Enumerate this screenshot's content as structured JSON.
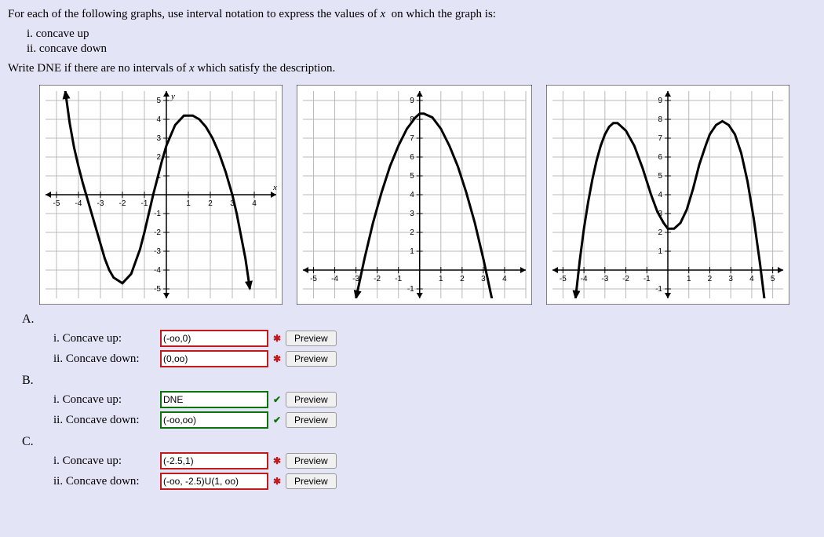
{
  "prompt": "For each of the following graphs, use interval notation to express the values of",
  "prompt_var": "x",
  "prompt_tail": "on which the graph is:",
  "sub_i": "i. concave up",
  "sub_ii": "ii. concave down",
  "dne_line_head": "Write DNE if there are no intervals of",
  "dne_line_tail": "which satisfy the description.",
  "preview_label": "Preview",
  "parts": {
    "A": {
      "label": "A."
    },
    "B": {
      "label": "B."
    },
    "C": {
      "label": "C."
    }
  },
  "rows": {
    "A_i": {
      "label": "i. Concave up:",
      "value": "(-oo,0)",
      "correct": false
    },
    "A_ii": {
      "label": "ii. Concave down:",
      "value": "(0,oo)",
      "correct": false
    },
    "B_i": {
      "label": "i. Concave up:",
      "value": "DNE",
      "correct": true
    },
    "B_ii": {
      "label": "ii. Concave down:",
      "value": "(-oo,oo)",
      "correct": true
    },
    "C_i": {
      "label": "i. Concave up:",
      "value": "(-2.5,1)",
      "correct": false
    },
    "C_ii": {
      "label": "ii. Concave down:",
      "value": "(-oo, -2.5)U(1, oo)",
      "correct": false
    }
  },
  "mark_wrong": "✱",
  "mark_right": "✔",
  "chart_data": [
    {
      "type": "line",
      "title": "",
      "xlabel": "x",
      "ylabel": "y",
      "xlim": [
        -5.5,
        5
      ],
      "ylim": [
        -5.5,
        5.5
      ],
      "xticks": [
        -5,
        -4,
        -3,
        -2,
        -1,
        1,
        2,
        3,
        4
      ],
      "yticks": [
        -5,
        -4,
        -3,
        -2,
        -1,
        1,
        2,
        3,
        4,
        5
      ],
      "series": [
        {
          "name": "curve",
          "x": [
            -4.6,
            -4.4,
            -4.2,
            -4.0,
            -3.8,
            -3.6,
            -3.4,
            -3.2,
            -3.0,
            -2.8,
            -2.6,
            -2.4,
            -2.0,
            -1.6,
            -1.2,
            -1.0,
            -0.6,
            -0.2,
            0.0,
            0.4,
            0.8,
            1.2,
            1.5,
            1.8,
            2.1,
            2.4,
            2.7,
            3.0,
            3.2,
            3.4,
            3.6,
            3.8
          ],
          "y": [
            5.5,
            3.8,
            2.5,
            1.5,
            0.6,
            -0.2,
            -1.0,
            -1.8,
            -2.6,
            -3.4,
            -4.0,
            -4.4,
            -4.7,
            -4.2,
            -2.9,
            -2.0,
            0.0,
            1.8,
            2.6,
            3.7,
            4.2,
            4.2,
            4.0,
            3.6,
            3.0,
            2.2,
            1.2,
            0.0,
            -1.0,
            -2.2,
            -3.4,
            -5.0
          ]
        }
      ],
      "arrows": {
        "left": true,
        "right": true
      }
    },
    {
      "type": "line",
      "title": "",
      "xlabel": "",
      "ylabel": "",
      "xlim": [
        -5.5,
        5
      ],
      "ylim": [
        -1.5,
        9.5
      ],
      "xticks": [
        -5,
        -4,
        -3,
        -2,
        -1,
        1,
        2,
        3,
        4
      ],
      "yticks": [
        -1,
        1,
        2,
        3,
        4,
        5,
        6,
        7,
        8,
        9
      ],
      "series": [
        {
          "name": "curve",
          "x": [
            -3.0,
            -2.6,
            -2.2,
            -1.8,
            -1.4,
            -1.0,
            -0.6,
            -0.2,
            0.0,
            0.2,
            0.6,
            1.0,
            1.4,
            1.8,
            2.2,
            2.6,
            3.0,
            3.4,
            3.8,
            4.2,
            4.4
          ],
          "y": [
            -1.5,
            0.6,
            2.5,
            4.1,
            5.5,
            6.6,
            7.5,
            8.1,
            8.3,
            8.3,
            8.1,
            7.5,
            6.6,
            5.5,
            4.1,
            2.5,
            0.6,
            -1.5,
            -3.8,
            -6.3,
            -8.0
          ]
        }
      ],
      "arrows": {
        "left": true,
        "right": true
      }
    },
    {
      "type": "line",
      "title": "",
      "xlabel": "",
      "ylabel": "",
      "xlim": [
        -5.5,
        5.5
      ],
      "ylim": [
        -1.5,
        9.5
      ],
      "xticks": [
        -5,
        -4,
        -3,
        -2,
        -1,
        1,
        2,
        3,
        4,
        5
      ],
      "yticks": [
        -1,
        1,
        2,
        3,
        4,
        5,
        6,
        7,
        8,
        9
      ],
      "series": [
        {
          "name": "curve",
          "x": [
            -4.4,
            -4.2,
            -4.0,
            -3.8,
            -3.6,
            -3.4,
            -3.2,
            -3.0,
            -2.8,
            -2.6,
            -2.4,
            -2.0,
            -1.6,
            -1.2,
            -0.8,
            -0.5,
            -0.2,
            0.0,
            0.3,
            0.6,
            0.9,
            1.2,
            1.5,
            1.8,
            2.0,
            2.3,
            2.6,
            2.9,
            3.2,
            3.5,
            3.8,
            4.1,
            4.4,
            4.7,
            4.9
          ],
          "y": [
            -1.5,
            0.5,
            2.2,
            3.6,
            4.8,
            5.8,
            6.6,
            7.2,
            7.6,
            7.8,
            7.8,
            7.4,
            6.6,
            5.4,
            4.0,
            3.1,
            2.5,
            2.2,
            2.2,
            2.5,
            3.2,
            4.3,
            5.6,
            6.6,
            7.2,
            7.7,
            7.9,
            7.7,
            7.2,
            6.2,
            4.7,
            2.7,
            0.3,
            -2.4,
            -4.5
          ]
        }
      ],
      "arrows": {
        "left": true,
        "right": true
      }
    }
  ]
}
